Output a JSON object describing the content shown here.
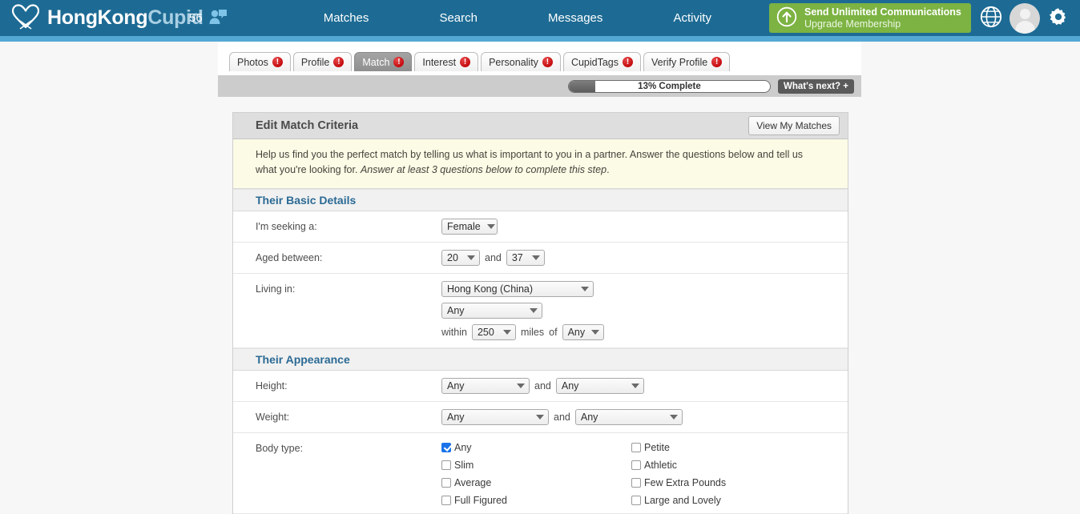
{
  "header": {
    "brand_first": "HongKong",
    "brand_second": "Cupid",
    "logo_icon": "heart-icon",
    "notification_count": "56",
    "notification_icon": "person-message-icon",
    "nav": [
      {
        "label": "Matches",
        "name": "nav-matches"
      },
      {
        "label": "Search",
        "name": "nav-search"
      },
      {
        "label": "Messages",
        "name": "nav-messages"
      },
      {
        "label": "Activity",
        "name": "nav-activity"
      }
    ],
    "upgrade": {
      "icon": "up-arrow-circle-icon",
      "title": "Send Unlimited Communications",
      "subtitle": "Upgrade Membership"
    },
    "icons": {
      "globe": "globe-icon",
      "avatar": "user-avatar-icon",
      "settings": "gear-icon"
    },
    "colors": {
      "navbar": "#1d6b94",
      "nav_underline": "#54a8d4",
      "upgrade_green": "#7cb342",
      "section_heading": "#2b6a94",
      "checkbox_blue": "#1a73e8",
      "badge_red": "#c2080b"
    }
  },
  "tabs": [
    {
      "label": "Photos",
      "badge": "!",
      "active": false
    },
    {
      "label": "Profile",
      "badge": "!",
      "active": false
    },
    {
      "label": "Match",
      "badge": "!",
      "active": true
    },
    {
      "label": "Interest",
      "badge": "!",
      "active": false
    },
    {
      "label": "Personality",
      "badge": "!",
      "active": false
    },
    {
      "label": "CupidTags",
      "badge": "!",
      "active": false
    },
    {
      "label": "Verify Profile",
      "badge": "!",
      "active": false
    }
  ],
  "progress": {
    "label": "13% Complete",
    "percent": 13,
    "whats_next": "What's next? +"
  },
  "panel": {
    "title": "Edit Match Criteria",
    "view_matches": "View My Matches",
    "help_text": "Help us find you the perfect match by telling us what is important to you in a partner. Answer the questions below and tell us what you're looking for. ",
    "help_emphasis": "Answer at least 3 questions below to complete this step",
    "help_period": "."
  },
  "sections": {
    "basic": {
      "heading": "Their Basic Details",
      "seeking_label": "I'm seeking a:",
      "seeking_value": "Female",
      "aged_label": "Aged between:",
      "age_min": "20",
      "age_and": "and",
      "age_max": "37",
      "living_label": "Living in:",
      "country": "Hong Kong (China)",
      "region": "Any",
      "within_text": "within",
      "distance": "250",
      "miles_text": "miles",
      "of_text": "of",
      "city": "Any"
    },
    "appearance": {
      "heading": "Their Appearance",
      "height_label": "Height:",
      "height_min": "Any",
      "height_and": "and",
      "height_max": "Any",
      "weight_label": "Weight:",
      "weight_min": "Any",
      "weight_and": "and",
      "weight_max": "Any",
      "body_label": "Body type:",
      "body_types": [
        {
          "label": "Any",
          "checked": true
        },
        {
          "label": "Petite",
          "checked": false
        },
        {
          "label": "Slim",
          "checked": false
        },
        {
          "label": "Athletic",
          "checked": false
        },
        {
          "label": "Average",
          "checked": false
        },
        {
          "label": "Few Extra Pounds",
          "checked": false
        },
        {
          "label": "Full Figured",
          "checked": false
        },
        {
          "label": "Large and Lovely",
          "checked": false
        }
      ]
    }
  }
}
